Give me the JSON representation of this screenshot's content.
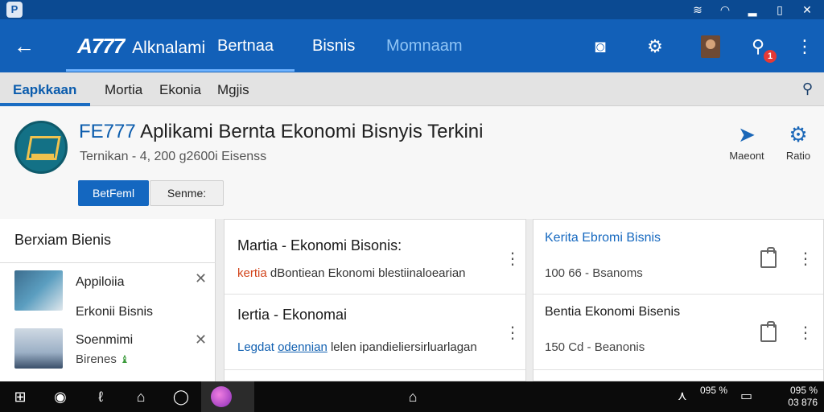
{
  "status_bar": {
    "app_icon": "P",
    "icons": [
      "signal-icon",
      "wifi-icon",
      "battery-level-icon",
      "battery-icon",
      "close-icon"
    ]
  },
  "app_bar": {
    "back_icon": "←",
    "logo_text": "A777",
    "brand_name": "Alknalami",
    "tabs": [
      {
        "label": "Bertnaa",
        "active": true
      },
      {
        "label": "Bisnis",
        "active": false
      },
      {
        "label": "Momnaam",
        "active": false
      }
    ],
    "notification_count": "1"
  },
  "category_bar": {
    "tabs": [
      {
        "label": "Eapkkaan",
        "active": true
      },
      {
        "label": "Mortia",
        "active": false
      },
      {
        "label": "Ekonia",
        "active": false
      },
      {
        "label": "Mgjis",
        "active": false
      }
    ]
  },
  "app_header": {
    "title_code": "FE777",
    "title_rest": "Aplikami Bernta Ekonomi Bisnyis Terkini",
    "subtitle": "Ternikan - 4, 200 g2600i Eisenss",
    "primary_button": "BetFeml",
    "secondary_button": "Senme:",
    "actions": [
      {
        "label": "Maeont",
        "icon": "share-arrow-icon"
      },
      {
        "label": "Ratio",
        "icon": "gear-icon"
      }
    ]
  },
  "sidebar": {
    "title": "Berxiam Bienis",
    "items": [
      {
        "line1": "Appiloiia",
        "line2": "Erkonii Bisnis"
      },
      {
        "line1": "Soenmimi",
        "line2": "Birenes"
      }
    ]
  },
  "cards_left": [
    {
      "title": "Martia - Ekonomi Bisonis:",
      "desc_red": "kertia",
      "desc_rest": " dBontiean Ekonomi blestiinaloearian"
    },
    {
      "title": "Iertia - Ekonomai",
      "desc_blue": "Legdat",
      "desc_link": "odennian",
      "desc_rest": " lelen ipandieliersirluarlagan"
    }
  ],
  "cards_right": [
    {
      "title": "Kerita Ebromi Bisnis",
      "meta": "100 66 - Bsanoms",
      "title_color": "#1568bf"
    },
    {
      "title": "Bentia Ekonomi Bisenis",
      "meta": "150 Cd - Beanonis",
      "title_color": "#1a1a1a"
    }
  ],
  "taskbar": {
    "tray_line1": "095 %",
    "tray_line2": "03 876"
  }
}
